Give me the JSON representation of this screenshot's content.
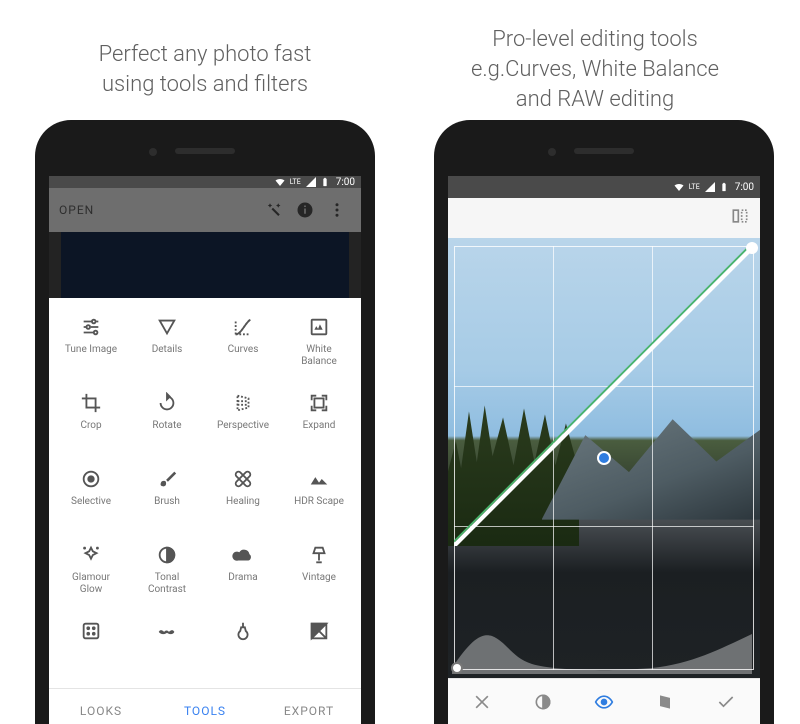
{
  "captions": {
    "left": "Perfect any photo fast\nusing tools and filters",
    "right": "Pro-level editing tools\ne.g.Curves, White Balance\nand RAW editing"
  },
  "statusbar": {
    "network": "LTE",
    "time": "7:00"
  },
  "screen1": {
    "header": {
      "open_label": "OPEN"
    },
    "tabs": {
      "looks": "LOOKS",
      "tools": "TOOLS",
      "export": "EXPORT",
      "active": "tools"
    },
    "tools": [
      {
        "id": "tune-image",
        "label": "Tune Image"
      },
      {
        "id": "details",
        "label": "Details"
      },
      {
        "id": "curves",
        "label": "Curves"
      },
      {
        "id": "white-balance",
        "label": "White\nBalance"
      },
      {
        "id": "crop",
        "label": "Crop"
      },
      {
        "id": "rotate",
        "label": "Rotate"
      },
      {
        "id": "perspective",
        "label": "Perspective"
      },
      {
        "id": "expand",
        "label": "Expand"
      },
      {
        "id": "selective",
        "label": "Selective"
      },
      {
        "id": "brush",
        "label": "Brush"
      },
      {
        "id": "healing",
        "label": "Healing"
      },
      {
        "id": "hdr-scape",
        "label": "HDR Scape"
      },
      {
        "id": "glamour-glow",
        "label": "Glamour\nGlow"
      },
      {
        "id": "tonal-contrast",
        "label": "Tonal\nContrast"
      },
      {
        "id": "drama",
        "label": "Drama"
      },
      {
        "id": "vintage",
        "label": "Vintage"
      },
      {
        "id": "grainy-film",
        "label": ""
      },
      {
        "id": "retrolux",
        "label": ""
      },
      {
        "id": "grunge",
        "label": ""
      },
      {
        "id": "bw",
        "label": ""
      }
    ]
  },
  "screen2": {
    "header_icon": "compare-icon",
    "active_channel": "luminance",
    "editbar": [
      {
        "id": "close",
        "icon": "close-icon"
      },
      {
        "id": "contrast",
        "icon": "contrast-icon"
      },
      {
        "id": "eye",
        "icon": "eye-icon",
        "active": true
      },
      {
        "id": "card",
        "icon": "card-icon"
      },
      {
        "id": "apply",
        "icon": "check-icon"
      }
    ]
  },
  "colors": {
    "accent": "#3a82f0",
    "muted": "#8a8a8a"
  }
}
